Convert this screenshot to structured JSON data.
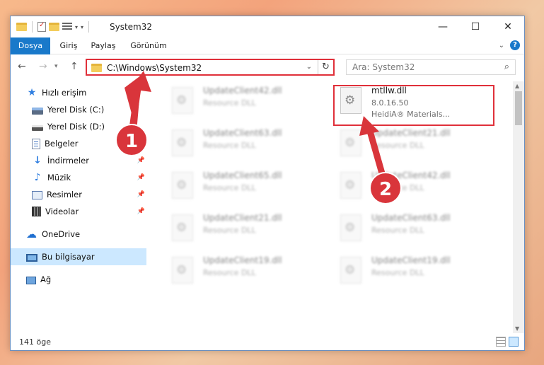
{
  "window": {
    "title": "System32",
    "controls": {
      "minimize": "—",
      "maximize": "☐",
      "close": "✕"
    }
  },
  "ribbon": {
    "tabs": [
      "Dosya",
      "Giriş",
      "Paylaş",
      "Görünüm"
    ],
    "help": "?"
  },
  "navigation": {
    "address": "C:\\Windows\\System32",
    "search_placeholder": "Ara: System32"
  },
  "sidebar": {
    "items": [
      {
        "label": "Hızlı erişim",
        "icon": "star-icon"
      },
      {
        "label": "Yerel Disk (C:)",
        "icon": "drive-icon"
      },
      {
        "label": "Yerel Disk (D:)",
        "icon": "drive-icon"
      },
      {
        "label": "Belgeler",
        "icon": "documents-icon"
      },
      {
        "label": "İndirmeler",
        "icon": "downloads-icon"
      },
      {
        "label": "Müzik",
        "icon": "music-icon"
      },
      {
        "label": "Resimler",
        "icon": "pictures-icon"
      },
      {
        "label": "Videolar",
        "icon": "videos-icon"
      },
      {
        "label": "OneDrive",
        "icon": "cloud-icon"
      },
      {
        "label": "Bu bilgisayar",
        "icon": "computer-icon"
      },
      {
        "label": "Ağ",
        "icon": "network-icon"
      }
    ]
  },
  "files": [
    {
      "name": "UpdateClient42.dll",
      "line2": "Resource DLL",
      "line3": ""
    },
    {
      "name": "mtllw.dll",
      "line2": "8.0.16.50",
      "line3": "HeidiA® Materials..."
    },
    {
      "name": "UpdateClient63.dll",
      "line2": "Resource DLL",
      "line3": ""
    },
    {
      "name": "UpdateClient21.dll",
      "line2": "Resource DLL",
      "line3": ""
    },
    {
      "name": "UpdateClient65.dll",
      "line2": "Resource DLL",
      "line3": ""
    },
    {
      "name": "UpdateClient42.dll",
      "line2": "Resource DLL",
      "line3": ""
    },
    {
      "name": "UpdateClient21.dll",
      "line2": "Resource DLL",
      "line3": ""
    },
    {
      "name": "UpdateClient63.dll",
      "line2": "Resource DLL",
      "line3": ""
    },
    {
      "name": "UpdateClient19.dll",
      "line2": "Resource DLL",
      "line3": ""
    },
    {
      "name": "UpdateClient19.dll",
      "line2": "Resource DLL",
      "line3": ""
    }
  ],
  "status": {
    "item_count": "141 öge"
  },
  "annotations": {
    "step1": "1",
    "step2": "2",
    "accent_color": "#e0303a"
  }
}
